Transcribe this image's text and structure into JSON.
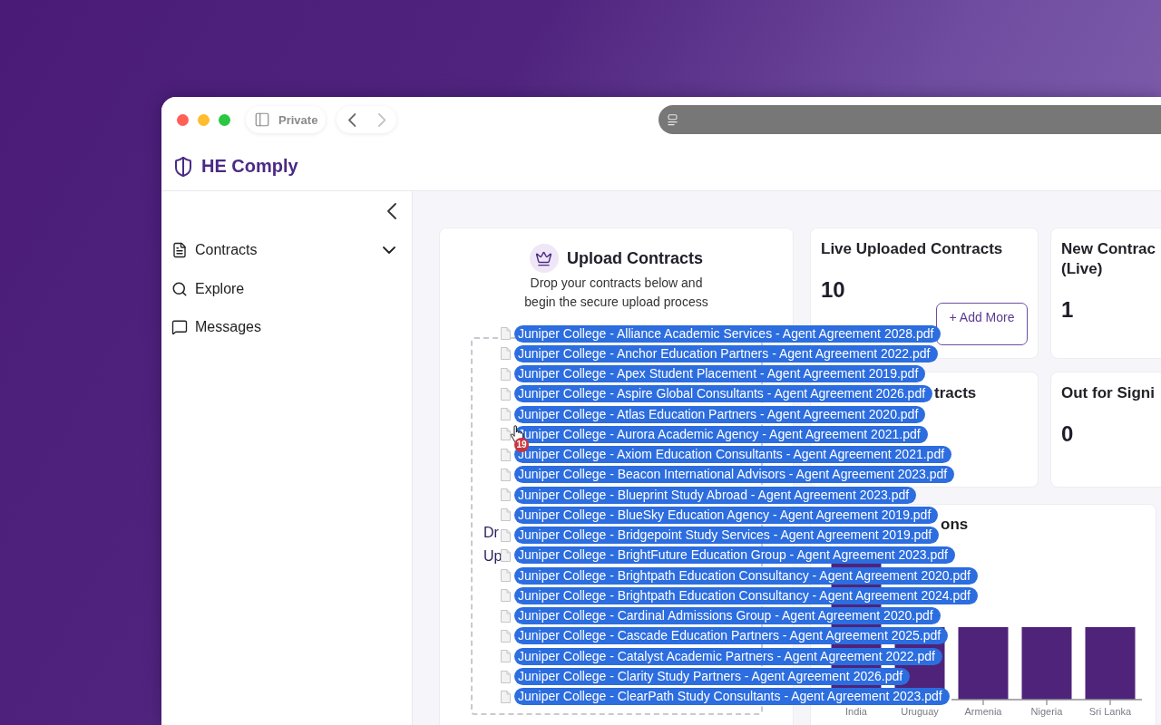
{
  "browser": {
    "private_label": "Private",
    "forward_disabled": true
  },
  "app": {
    "name": "HE Comply"
  },
  "sidebar": {
    "items": [
      {
        "label": "Contracts",
        "kind": "file",
        "expandable": true
      },
      {
        "label": "Explore",
        "kind": "search",
        "expandable": false
      },
      {
        "label": "Messages",
        "kind": "message",
        "expandable": false
      }
    ]
  },
  "upload": {
    "title": "Upload Contracts",
    "description": "Drop your contracts below and begin the secure upload process",
    "drop_zone_lines": [
      "Dr",
      "Up"
    ]
  },
  "stats": [
    {
      "title": "Live Uploaded Contracts",
      "title_covered": false,
      "value": "10",
      "action": "+ Add More"
    },
    {
      "title": "New Contrac (Live)",
      "title_covered": false,
      "value": "1"
    },
    {
      "title": "tracts",
      "title_covered": true
    },
    {
      "title": "Out for Signi",
      "title_covered": false,
      "value": "0"
    }
  ],
  "chart": {
    "title": "ons",
    "title_covered": true,
    "x_labels": [
      "India",
      "Uruguay",
      "Armenia",
      "Nigeria",
      "Sri Lanka"
    ]
  },
  "drag": {
    "count": "19",
    "files": [
      "Juniper College - Alliance Academic Services - Agent Agreement 2028.pdf",
      "Juniper College - Anchor Education Partners - Agent Agreement 2022.pdf",
      "Juniper College - Apex Student Placement - Agent Agreement 2019.pdf",
      "Juniper College - Aspire Global Consultants - Agent Agreement 2026.pdf",
      "Juniper College - Atlas Education Partners - Agent Agreement 2020.pdf",
      "Juniper College - Aurora Academic Agency - Agent Agreement 2021.pdf",
      "Juniper College - Axiom Education Consultants - Agent Agreement 2021.pdf",
      "Juniper College - Beacon International Advisors - Agent Agreement 2023.pdf",
      "Juniper College - Blueprint Study Abroad - Agent Agreement 2023.pdf",
      "Juniper College - BlueSky Education Agency - Agent Agreement 2019.pdf",
      "Juniper College - Bridgepoint Study Services - Agent Agreement 2019.pdf",
      "Juniper College - BrightFuture Education Group - Agent Agreement 2023.pdf",
      "Juniper College - Brightpath Education Consultancy - Agent Agreement 2020.pdf",
      "Juniper College - Brightpath Education Consultancy - Agent Agreement 2024.pdf",
      "Juniper College - Cardinal Admissions Group - Agent Agreement 2020.pdf",
      "Juniper College - Cascade Education Partners - Agent Agreement 2025.pdf",
      "Juniper College - Catalyst Academic Partners - Agent Agreement 2022.pdf",
      "Juniper College - Clarity Study Partners - Agent Agreement 2026.pdf",
      "Juniper College - ClearPath Study Consultants - Agent Agreement 2023.pdf"
    ]
  }
}
